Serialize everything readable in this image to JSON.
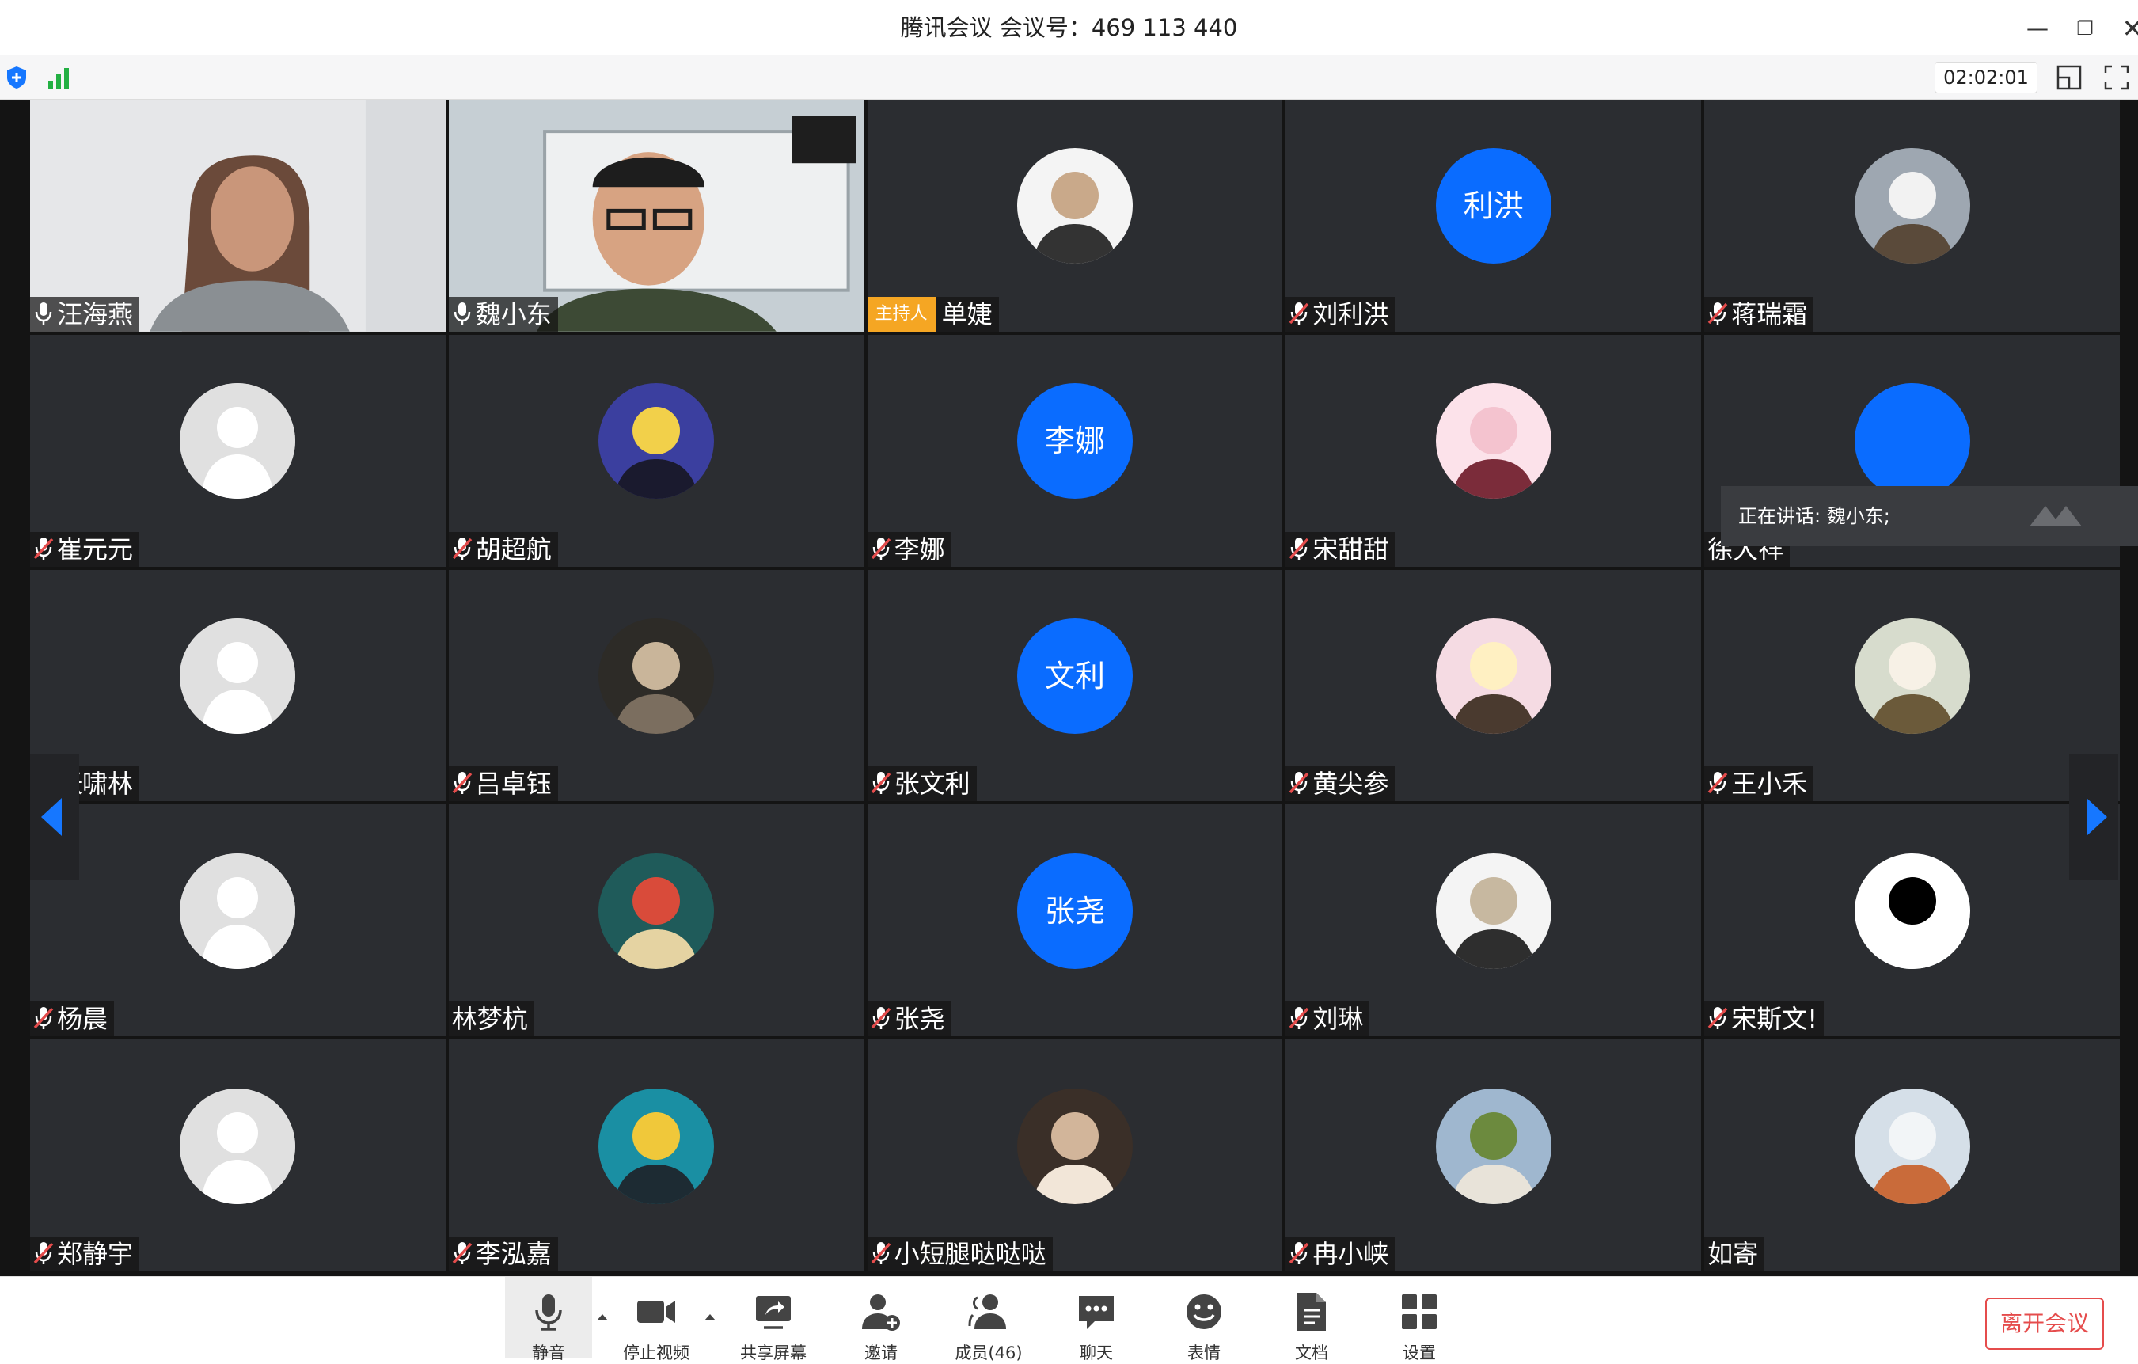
{
  "window": {
    "title": "腾讯会议 会议号：469 113 440",
    "minimize_icon": "minimize-icon",
    "restore_icon": "restore-icon",
    "close_icon": "close-icon"
  },
  "infobar": {
    "timer": "02:02:01",
    "shield_icon": "shield-icon",
    "signal_icon": "signal-bars-icon",
    "layout_icon": "layout-icon",
    "fullscreen_icon": "fullscreen-icon"
  },
  "colors": {
    "accent": "#0a6cff",
    "host_badge": "#f5a623",
    "leave": "#e54c4c",
    "tile_bg": "#2b2d31",
    "muted_icon": "#e54c4c"
  },
  "participants": [
    {
      "name": "汪海燕",
      "type": "video",
      "mic": "on"
    },
    {
      "name": "魏小东",
      "type": "video",
      "mic": "on"
    },
    {
      "name": "单婕",
      "type": "image",
      "mic": "none",
      "host": true
    },
    {
      "name": "刘利洪",
      "type": "text",
      "avatar_text": "利洪",
      "mic": "muted"
    },
    {
      "name": "蒋瑞霜",
      "type": "image",
      "mic": "muted"
    },
    {
      "name": "崔元元",
      "type": "default",
      "mic": "muted"
    },
    {
      "name": "胡超航",
      "type": "image",
      "mic": "muted"
    },
    {
      "name": "李娜",
      "type": "text",
      "avatar_text": "李娜",
      "mic": "muted"
    },
    {
      "name": "宋甜甜",
      "type": "image",
      "mic": "muted"
    },
    {
      "name": "徐大祥",
      "type": "text",
      "avatar_text": "",
      "mic": "none"
    },
    {
      "name": "张啸林",
      "type": "default",
      "mic": "muted"
    },
    {
      "name": "吕卓钰",
      "type": "image",
      "mic": "muted"
    },
    {
      "name": "张文利",
      "type": "text",
      "avatar_text": "文利",
      "mic": "muted"
    },
    {
      "name": "黄尖参",
      "type": "image",
      "mic": "muted"
    },
    {
      "name": "王小禾",
      "type": "image",
      "mic": "muted"
    },
    {
      "name": "杨晨",
      "type": "default",
      "mic": "muted"
    },
    {
      "name": "林梦杭",
      "type": "image",
      "mic": "none"
    },
    {
      "name": "张尧",
      "type": "text",
      "avatar_text": "张尧",
      "mic": "muted"
    },
    {
      "name": "刘琳",
      "type": "image",
      "mic": "muted"
    },
    {
      "name": "宋斯文!",
      "type": "image",
      "mic": "muted"
    },
    {
      "name": "郑静宇",
      "type": "default",
      "mic": "muted"
    },
    {
      "name": "李泓嘉",
      "type": "image",
      "mic": "muted"
    },
    {
      "name": "小短腿哒哒哒",
      "type": "image",
      "mic": "muted"
    },
    {
      "name": "冉小峡",
      "type": "image",
      "mic": "muted"
    },
    {
      "name": "如寄",
      "type": "image",
      "mic": "none"
    }
  ],
  "host_badge_label": "主持人",
  "speaking_toast": "正在讲话: 魏小东;",
  "toolbar": {
    "items": [
      {
        "label": "静音",
        "icon": "microphone-icon"
      },
      {
        "label": "停止视频",
        "icon": "video-camera-icon"
      },
      {
        "label": "共享屏幕",
        "icon": "share-screen-icon"
      },
      {
        "label": "邀请",
        "icon": "invite-user-icon"
      },
      {
        "label": "成员(46)",
        "icon": "members-icon"
      },
      {
        "label": "聊天",
        "icon": "chat-icon"
      },
      {
        "label": "表情",
        "icon": "emoji-icon"
      },
      {
        "label": "文档",
        "icon": "document-icon"
      },
      {
        "label": "设置",
        "icon": "settings-icon"
      }
    ],
    "leave_label": "离开会议"
  }
}
